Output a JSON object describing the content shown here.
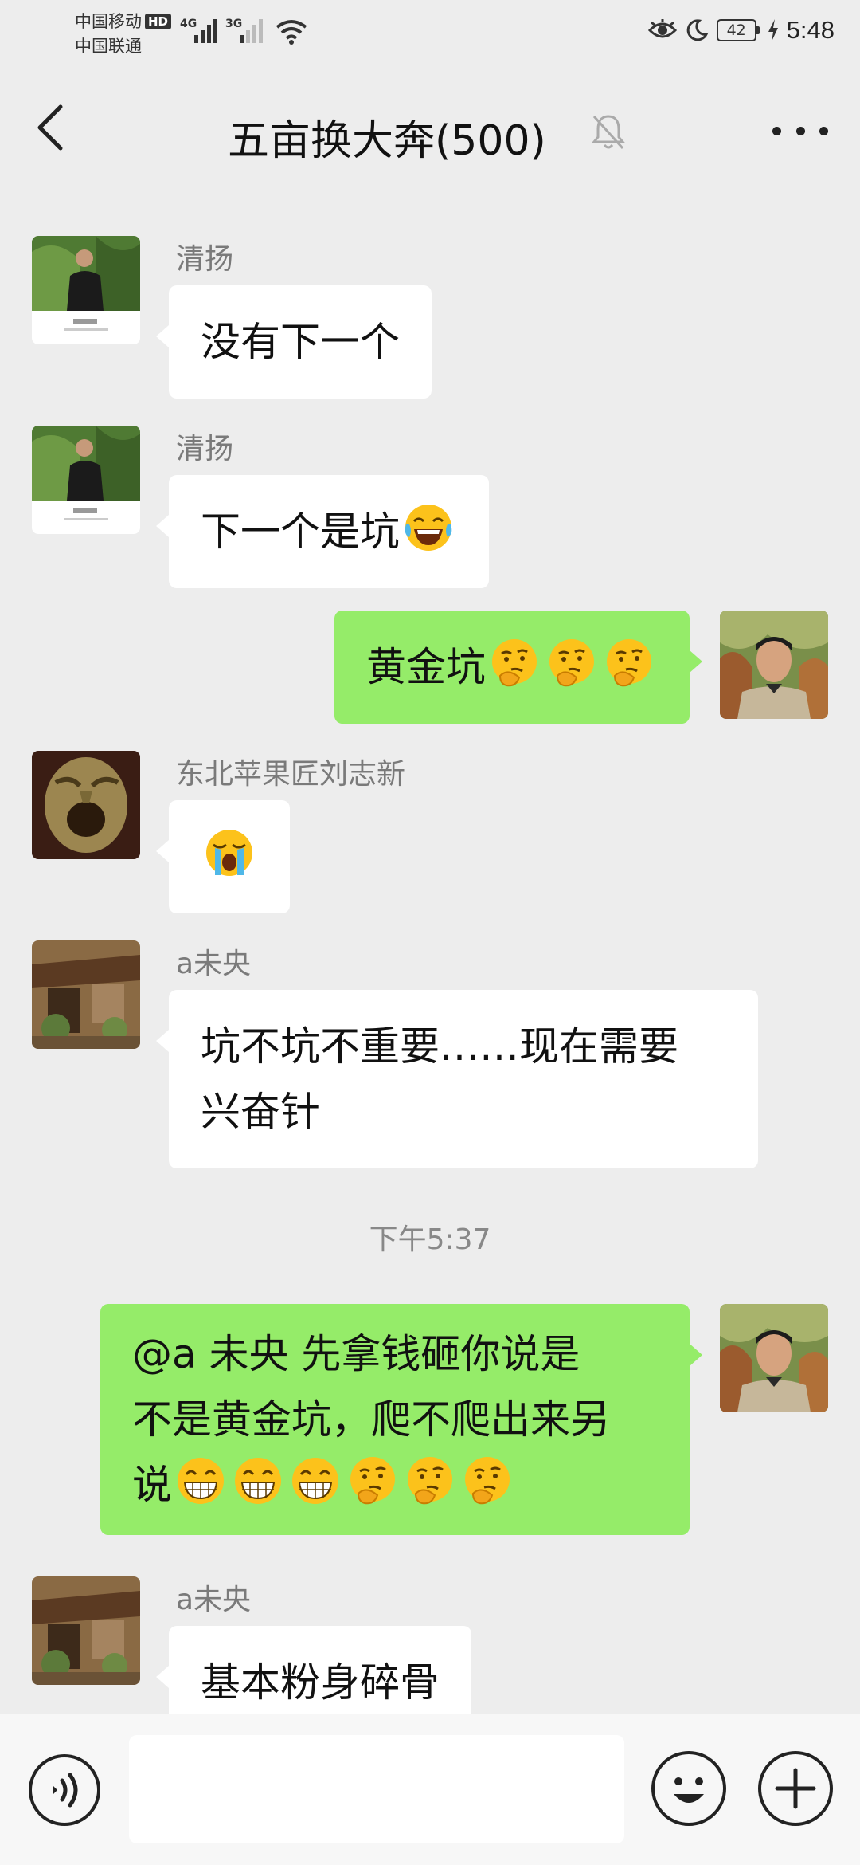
{
  "status_bar": {
    "carrier_1": "中国移动",
    "carrier_1_badge": "HD",
    "carrier_2": "中国联通",
    "net_1": "4G",
    "net_2": "3G",
    "battery": "42",
    "time": "5:48"
  },
  "nav": {
    "title": "五亩换大奔(500)"
  },
  "messages": [
    {
      "direction": "in",
      "sender": "清扬",
      "text": "没有下一个"
    },
    {
      "direction": "in",
      "sender": "清扬",
      "text": "下一个是坑",
      "emojis": [
        "laugh-tears"
      ]
    },
    {
      "direction": "out",
      "text": "黄金坑",
      "emojis": [
        "thinking",
        "thinking",
        "thinking"
      ]
    },
    {
      "direction": "in",
      "sender": "东北苹果匠刘志新",
      "text": "",
      "emojis": [
        "crying"
      ]
    },
    {
      "direction": "in",
      "sender": "a未央",
      "lines": [
        "坑不坑不重要……现在需要",
        "兴奋针"
      ]
    },
    {
      "direction": "out",
      "lines": [
        "@a 未央  先拿钱砸你说是",
        "不是黄金坑，爬不爬出来另",
        "说"
      ],
      "emojis": [
        "grin",
        "grin",
        "grin",
        "thinking",
        "thinking",
        "thinking"
      ]
    },
    {
      "direction": "in",
      "sender": "a未央",
      "text": "基本粉身碎骨"
    }
  ],
  "timestamp": "下午5:37",
  "colors": {
    "background": "#ededed",
    "incoming_bubble": "#ffffff",
    "outgoing_bubble": "#95ec69"
  }
}
